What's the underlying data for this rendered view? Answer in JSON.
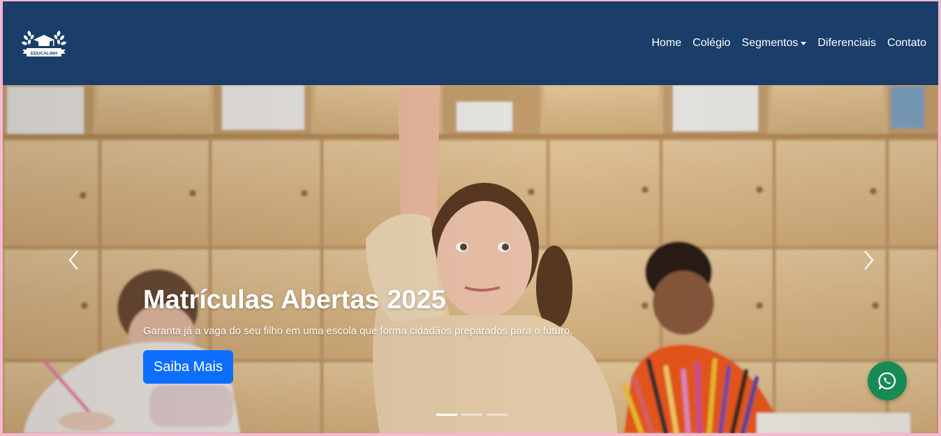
{
  "brand": {
    "logo_text": "EDUCALINH"
  },
  "nav": {
    "items": [
      {
        "label": "Home"
      },
      {
        "label": "Colégio"
      },
      {
        "label": "Segmentos",
        "has_dropdown": true
      },
      {
        "label": "Diferenciais"
      },
      {
        "label": "Contato"
      }
    ]
  },
  "hero": {
    "title": "Matrículas Abertas 2025",
    "subtitle": "Garanta já a vaga do seu filho em uma escola que forma cidadãos preparados para o futuro.",
    "cta_label": "Saiba Mais",
    "slide_count": 3,
    "active_slide": 1
  },
  "colors": {
    "navbar": "#1a3d69",
    "cta": "#0d6efd",
    "whatsapp": "#1a8a55",
    "page_border": "#f5b8cf"
  },
  "icons": {
    "prev": "chevron-left-icon",
    "next": "chevron-right-icon",
    "whatsapp": "whatsapp-icon"
  }
}
